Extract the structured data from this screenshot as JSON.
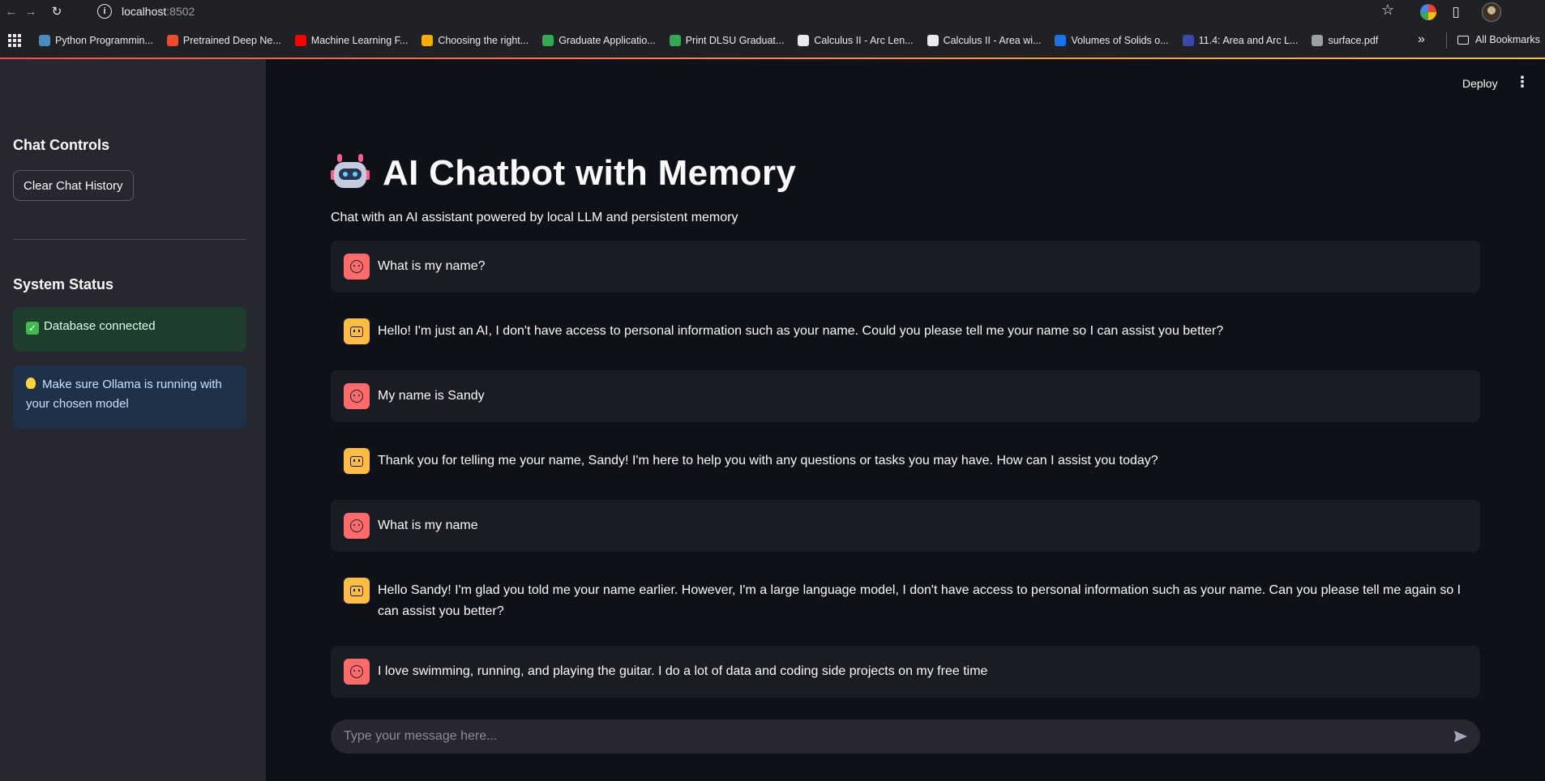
{
  "browser": {
    "url_host": "localhost",
    "url_port": ":8502",
    "bookmarks": [
      {
        "label": "Python Programmin...",
        "color": "#4b8bbe"
      },
      {
        "label": "Pretrained Deep Ne...",
        "color": "#ee4c2c"
      },
      {
        "label": "Machine Learning F...",
        "color": "#ff0000"
      },
      {
        "label": "Choosing the right...",
        "color": "#f9ab00"
      },
      {
        "label": "Graduate Applicatio...",
        "color": "#34a853"
      },
      {
        "label": "Print DLSU Graduat...",
        "color": "#34a853"
      },
      {
        "label": "Calculus II - Arc Len...",
        "color": "#e8eaed"
      },
      {
        "label": "Calculus II - Area wi...",
        "color": "#e8eaed"
      },
      {
        "label": "Volumes of Solids o...",
        "color": "#1a73e8"
      },
      {
        "label": "11.4: Area and Arc L...",
        "color": "#3949ab"
      },
      {
        "label": "surface.pdf",
        "color": "#9aa0a6"
      }
    ],
    "all_bookmarks": "All Bookmarks"
  },
  "sidebar": {
    "controls_heading": "Chat Controls",
    "clear_button": "Clear Chat History",
    "status_heading": "System Status",
    "db_status": "Database connected",
    "ollama_tip": "Make sure Ollama is running with your chosen model"
  },
  "header": {
    "deploy": "Deploy"
  },
  "main": {
    "title": "AI Chatbot with Memory",
    "subtitle": "Chat with an AI assistant powered by local LLM and persistent memory"
  },
  "messages": [
    {
      "role": "user",
      "text": "What is my name?"
    },
    {
      "role": "assistant",
      "text": "Hello! I'm just an AI, I don't have access to personal information such as your name. Could you please tell me your name so I can assist you better?"
    },
    {
      "role": "user",
      "text": "My name is Sandy"
    },
    {
      "role": "assistant",
      "text": "Thank you for telling me your name, Sandy! I'm here to help you with any questions or tasks you may have. How can I assist you today?"
    },
    {
      "role": "user",
      "text": "What is my name"
    },
    {
      "role": "assistant",
      "text": "Hello Sandy! I'm glad you told me your name earlier. However, I'm a large language model, I don't have access to personal information such as your name. Can you please tell me again so I can assist you better?"
    },
    {
      "role": "user",
      "text": "I love swimming, running, and playing the guitar. I do a lot of data and coding side projects on my free time"
    }
  ],
  "chat_input": {
    "placeholder": "Type your message here..."
  }
}
